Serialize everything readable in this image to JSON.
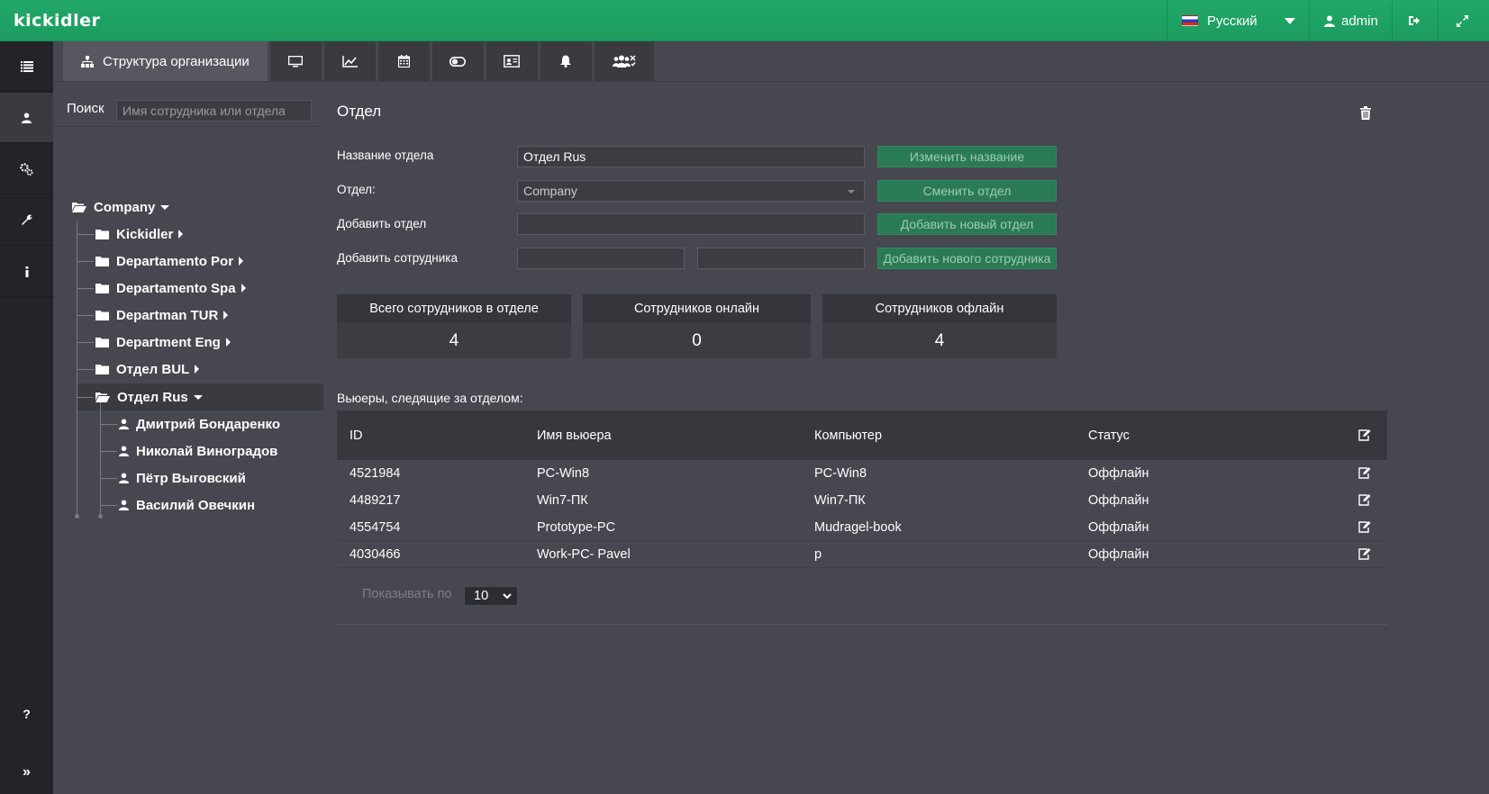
{
  "app": {
    "logo": "kickidler"
  },
  "topbar": {
    "language": "Русский",
    "user": "admin"
  },
  "tabs": [
    {
      "label": "Структура организации",
      "icon": "sitemap-icon"
    },
    {
      "icon": "monitor-icon"
    },
    {
      "icon": "line-chart-icon"
    },
    {
      "icon": "calendar-icon"
    },
    {
      "icon": "toggle-icon"
    },
    {
      "icon": "id-card-icon"
    },
    {
      "icon": "bell-icon"
    },
    {
      "icon": "users-settings-icon"
    }
  ],
  "search": {
    "label": "Поиск",
    "placeholder": "Имя сотрудника или отдела"
  },
  "tree": {
    "root": "Company",
    "folders": [
      "Kickidler",
      "Departamento Por",
      "Departamento Spa",
      "Departman TUR",
      "Department Eng",
      "Отдел BUL",
      "Отдел Rus"
    ],
    "employees": [
      "Дмитрий Бондаренко",
      "Николай Виноградов",
      "Пётр Выговский",
      "Василий Овечкин"
    ]
  },
  "department": {
    "title": "Отдел",
    "name_label": "Название отдела",
    "name_value": "Отдел Rus",
    "rename_button": "Изменить название",
    "parent_label": "Отдел:",
    "parent_value": "Company",
    "change_parent_button": "Сменить отдел",
    "add_dept_label": "Добавить отдел",
    "add_dept_button": "Добавить новый отдел",
    "add_employee_label": "Добавить сотрудника",
    "add_employee_button": "Добавить нового сотрудника"
  },
  "stats": [
    {
      "label": "Всего сотрудников в отделе",
      "value": "4"
    },
    {
      "label": "Сотрудников онлайн",
      "value": "0"
    },
    {
      "label": "Сотрудников офлайн",
      "value": "4"
    }
  ],
  "viewers": {
    "label": "Вьюеры, следящие за отделом:",
    "columns": [
      "ID",
      "Имя вьюера",
      "Компьютер",
      "Статус"
    ],
    "rows": [
      [
        "4521984",
        "PC-Win8",
        "PC-Win8",
        "Оффлайн"
      ],
      [
        "4489217",
        "Win7-ПК",
        "Win7-ПК",
        "Оффлайн"
      ],
      [
        "4554754",
        "Prototype-PC",
        "Mudragel-book",
        "Оффлайн"
      ],
      [
        "4030466",
        "Work-PC- Pavel",
        "p",
        "Оффлайн"
      ]
    ]
  },
  "pager": {
    "label": "Показывать по",
    "value": "10"
  },
  "sidebar": {
    "help": "?",
    "expand": "»"
  },
  "colors": {
    "topbar": "#1ea564",
    "sidebar": "#242428",
    "background": "#474750",
    "button": "#2a7a55"
  }
}
